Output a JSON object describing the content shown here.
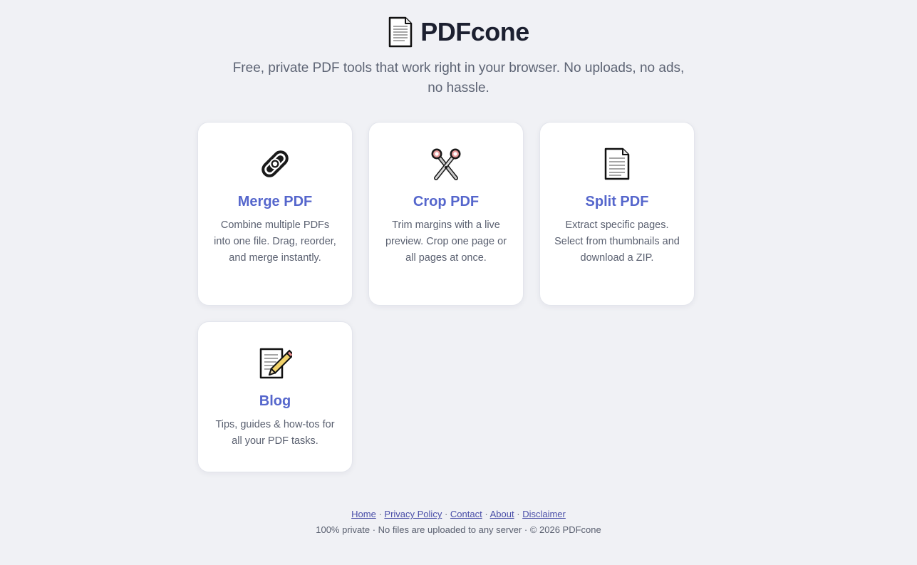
{
  "header": {
    "logo_icon": "page-document-icon",
    "title": "PDFcone",
    "tagline": "Free, private PDF tools that work right in your browser. No uploads, no ads, no hassle."
  },
  "tools": [
    {
      "icon": "link-icon",
      "title": "Merge PDF",
      "description": "Combine multiple PDFs into one file. Drag, reorder, and merge instantly."
    },
    {
      "icon": "scissors-icon",
      "title": "Crop PDF",
      "description": "Trim margins with a live preview. Crop one page or all pages at once."
    },
    {
      "icon": "page-document-icon",
      "title": "Split PDF",
      "description": "Extract specific pages. Select from thumbnails and download a ZIP."
    },
    {
      "icon": "memo-pencil-icon",
      "title": "Blog",
      "description": "Tips, guides & how-tos for all your PDF tasks."
    }
  ],
  "footer": {
    "links": [
      "Home",
      "Privacy Policy",
      "Contact",
      "About",
      "Disclaimer"
    ],
    "separator": "·",
    "note": "100% private · No files are uploaded to any server · © 2026 PDFcone"
  },
  "colors": {
    "background": "#f0f1f5",
    "accent": "#5566cc",
    "card": "#ffffff",
    "link": "#4a4fa8"
  }
}
